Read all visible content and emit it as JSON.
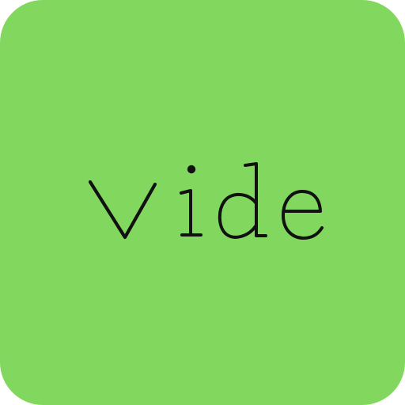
{
  "icon": {
    "text": "Vide",
    "background_color": "#82D85E",
    "text_color": "#111111"
  }
}
